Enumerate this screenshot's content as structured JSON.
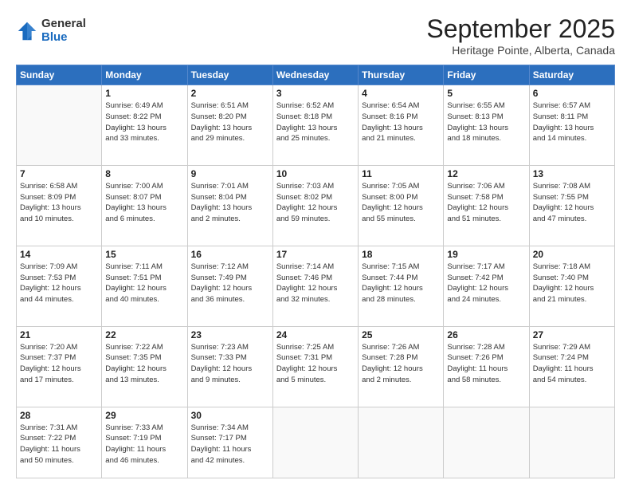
{
  "logo": {
    "general": "General",
    "blue": "Blue"
  },
  "title": "September 2025",
  "location": "Heritage Pointe, Alberta, Canada",
  "days_of_week": [
    "Sunday",
    "Monday",
    "Tuesday",
    "Wednesday",
    "Thursday",
    "Friday",
    "Saturday"
  ],
  "weeks": [
    [
      {
        "day": "",
        "info": ""
      },
      {
        "day": "1",
        "info": "Sunrise: 6:49 AM\nSunset: 8:22 PM\nDaylight: 13 hours\nand 33 minutes."
      },
      {
        "day": "2",
        "info": "Sunrise: 6:51 AM\nSunset: 8:20 PM\nDaylight: 13 hours\nand 29 minutes."
      },
      {
        "day": "3",
        "info": "Sunrise: 6:52 AM\nSunset: 8:18 PM\nDaylight: 13 hours\nand 25 minutes."
      },
      {
        "day": "4",
        "info": "Sunrise: 6:54 AM\nSunset: 8:16 PM\nDaylight: 13 hours\nand 21 minutes."
      },
      {
        "day": "5",
        "info": "Sunrise: 6:55 AM\nSunset: 8:13 PM\nDaylight: 13 hours\nand 18 minutes."
      },
      {
        "day": "6",
        "info": "Sunrise: 6:57 AM\nSunset: 8:11 PM\nDaylight: 13 hours\nand 14 minutes."
      }
    ],
    [
      {
        "day": "7",
        "info": "Sunrise: 6:58 AM\nSunset: 8:09 PM\nDaylight: 13 hours\nand 10 minutes."
      },
      {
        "day": "8",
        "info": "Sunrise: 7:00 AM\nSunset: 8:07 PM\nDaylight: 13 hours\nand 6 minutes."
      },
      {
        "day": "9",
        "info": "Sunrise: 7:01 AM\nSunset: 8:04 PM\nDaylight: 13 hours\nand 2 minutes."
      },
      {
        "day": "10",
        "info": "Sunrise: 7:03 AM\nSunset: 8:02 PM\nDaylight: 12 hours\nand 59 minutes."
      },
      {
        "day": "11",
        "info": "Sunrise: 7:05 AM\nSunset: 8:00 PM\nDaylight: 12 hours\nand 55 minutes."
      },
      {
        "day": "12",
        "info": "Sunrise: 7:06 AM\nSunset: 7:58 PM\nDaylight: 12 hours\nand 51 minutes."
      },
      {
        "day": "13",
        "info": "Sunrise: 7:08 AM\nSunset: 7:55 PM\nDaylight: 12 hours\nand 47 minutes."
      }
    ],
    [
      {
        "day": "14",
        "info": "Sunrise: 7:09 AM\nSunset: 7:53 PM\nDaylight: 12 hours\nand 44 minutes."
      },
      {
        "day": "15",
        "info": "Sunrise: 7:11 AM\nSunset: 7:51 PM\nDaylight: 12 hours\nand 40 minutes."
      },
      {
        "day": "16",
        "info": "Sunrise: 7:12 AM\nSunset: 7:49 PM\nDaylight: 12 hours\nand 36 minutes."
      },
      {
        "day": "17",
        "info": "Sunrise: 7:14 AM\nSunset: 7:46 PM\nDaylight: 12 hours\nand 32 minutes."
      },
      {
        "day": "18",
        "info": "Sunrise: 7:15 AM\nSunset: 7:44 PM\nDaylight: 12 hours\nand 28 minutes."
      },
      {
        "day": "19",
        "info": "Sunrise: 7:17 AM\nSunset: 7:42 PM\nDaylight: 12 hours\nand 24 minutes."
      },
      {
        "day": "20",
        "info": "Sunrise: 7:18 AM\nSunset: 7:40 PM\nDaylight: 12 hours\nand 21 minutes."
      }
    ],
    [
      {
        "day": "21",
        "info": "Sunrise: 7:20 AM\nSunset: 7:37 PM\nDaylight: 12 hours\nand 17 minutes."
      },
      {
        "day": "22",
        "info": "Sunrise: 7:22 AM\nSunset: 7:35 PM\nDaylight: 12 hours\nand 13 minutes."
      },
      {
        "day": "23",
        "info": "Sunrise: 7:23 AM\nSunset: 7:33 PM\nDaylight: 12 hours\nand 9 minutes."
      },
      {
        "day": "24",
        "info": "Sunrise: 7:25 AM\nSunset: 7:31 PM\nDaylight: 12 hours\nand 5 minutes."
      },
      {
        "day": "25",
        "info": "Sunrise: 7:26 AM\nSunset: 7:28 PM\nDaylight: 12 hours\nand 2 minutes."
      },
      {
        "day": "26",
        "info": "Sunrise: 7:28 AM\nSunset: 7:26 PM\nDaylight: 11 hours\nand 58 minutes."
      },
      {
        "day": "27",
        "info": "Sunrise: 7:29 AM\nSunset: 7:24 PM\nDaylight: 11 hours\nand 54 minutes."
      }
    ],
    [
      {
        "day": "28",
        "info": "Sunrise: 7:31 AM\nSunset: 7:22 PM\nDaylight: 11 hours\nand 50 minutes."
      },
      {
        "day": "29",
        "info": "Sunrise: 7:33 AM\nSunset: 7:19 PM\nDaylight: 11 hours\nand 46 minutes."
      },
      {
        "day": "30",
        "info": "Sunrise: 7:34 AM\nSunset: 7:17 PM\nDaylight: 11 hours\nand 42 minutes."
      },
      {
        "day": "",
        "info": ""
      },
      {
        "day": "",
        "info": ""
      },
      {
        "day": "",
        "info": ""
      },
      {
        "day": "",
        "info": ""
      }
    ]
  ]
}
